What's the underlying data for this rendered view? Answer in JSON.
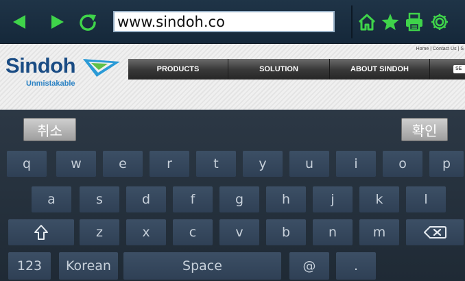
{
  "toolbar": {
    "url": "www.sindoh.co",
    "icons": [
      "back-arrow-icon",
      "forward-arrow-icon",
      "reload-icon",
      "home-icon",
      "star-icon",
      "print-icon",
      "gear-icon"
    ],
    "accent_color": "#3fd44a"
  },
  "webpage": {
    "logo_text": "Sindoh",
    "logo_tagline": "Unmistakable",
    "top_links": "Home | Contact Us | S",
    "nav_items": [
      "PRODUCTS",
      "SOLUTION",
      "ABOUT SINDOH"
    ],
    "search_placeholder": "SE"
  },
  "keyboard": {
    "cancel_label": "취소",
    "ok_label": "확인",
    "row1": [
      "q",
      "w",
      "e",
      "r",
      "t",
      "y",
      "u",
      "i",
      "o",
      "p"
    ],
    "row2": [
      "a",
      "s",
      "d",
      "f",
      "g",
      "h",
      "j",
      "k",
      "l"
    ],
    "row3": [
      "z",
      "x",
      "c",
      "v",
      "b",
      "n",
      "m"
    ],
    "shift_icon": "shift-arrow-icon",
    "backspace_icon": "backspace-icon",
    "numbers_label": "123",
    "language_label": "Korean",
    "space_label": "Space",
    "at_label": "@",
    "dot_label": "."
  }
}
